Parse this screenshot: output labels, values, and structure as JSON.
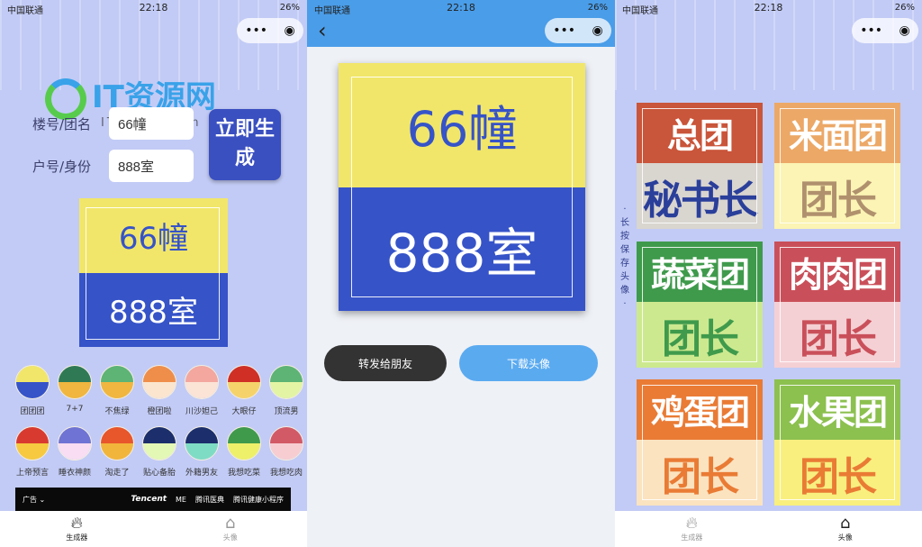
{
  "status": {
    "carrier": "中国联通",
    "time": "22:18",
    "battery": "26%"
  },
  "capsule": {
    "more": "•••",
    "close": "◉"
  },
  "generator": {
    "watermark": "IT资源网",
    "watermark_url": "ITbaizu.com",
    "building_label": "楼号/团名",
    "building_value": "66幢",
    "room_label": "户号/身份",
    "room_value": "888室",
    "generate_button": "立即生成",
    "preview": {
      "top": "66幢",
      "bottom": "888室",
      "top_color": "#f1e66a",
      "bottom_color": "#3653c8"
    },
    "themes": [
      {
        "name": "团团团",
        "top": "#f1e66a",
        "bottom": "#3653c8"
      },
      {
        "name": "7+7",
        "top": "#2f7a55",
        "bottom": "#f0b63f"
      },
      {
        "name": "不焦绿",
        "top": "#5db474",
        "bottom": "#f0b63f"
      },
      {
        "name": "橙团啦",
        "top": "#ef8e4a",
        "bottom": "#fbe5cf"
      },
      {
        "name": "川沙妲己",
        "top": "#f3a79e",
        "bottom": "#fbe3d6"
      },
      {
        "name": "大眼仔",
        "top": "#cf2f25",
        "bottom": "#f6d36a"
      },
      {
        "name": "顶流男",
        "top": "#5db474",
        "bottom": "#e3f5a4"
      },
      {
        "name": "上帝预言",
        "top": "#d93a30",
        "bottom": "#f6c940"
      },
      {
        "name": "睡衣神颜",
        "top": "#6f73d3",
        "bottom": "#f8ddf3"
      },
      {
        "name": "淘走了",
        "top": "#e8562c",
        "bottom": "#f2b53c"
      },
      {
        "name": "贴心备胎",
        "top": "#1c2f6c",
        "bottom": "#e4f8b6"
      },
      {
        "name": "外籍男友",
        "top": "#1c2f6c",
        "bottom": "#7fdcc4"
      },
      {
        "name": "我想吃菜",
        "top": "#3f9a4c",
        "bottom": "#eef06a"
      },
      {
        "name": "我想吃肉",
        "top": "#d25a66",
        "bottom": "#f7cdd2"
      }
    ],
    "ad": {
      "label": "广告 ⌄",
      "brands": [
        "Tencent",
        "ME",
        "腾讯医典",
        "腾讯健康小程序"
      ]
    }
  },
  "tabs": [
    {
      "label": "生成器",
      "icon": "flame-icon"
    },
    {
      "label": "头像",
      "icon": "home-icon"
    }
  ],
  "result": {
    "back": "‹",
    "preview": {
      "top": "66幢",
      "bottom": "888室"
    },
    "share_button": "转发给朋友",
    "download_button": "下载头像"
  },
  "gallery": {
    "hint": "·长按保存头像·",
    "cards": [
      {
        "top": "总团",
        "bottom": "秘书长",
        "top_color": "#c9553a",
        "bottom_color": "#d9d5cf",
        "text_color": "#2a3f9a"
      },
      {
        "top": "米面团",
        "bottom": "团长",
        "top_color": "#eca867",
        "bottom_color": "#fbf4b4",
        "text_color": "#b0916e"
      },
      {
        "top": "蔬菜团",
        "bottom": "团长",
        "top_color": "#3f9a4c",
        "bottom_color": "#cde98f",
        "text_color": "#3f9a4c"
      },
      {
        "top": "肉肉团",
        "bottom": "团长",
        "top_color": "#c9505a",
        "bottom_color": "#f4d0d4",
        "text_color": "#c9505a"
      },
      {
        "top": "鸡蛋团",
        "bottom": "团长",
        "top_color": "#e97b35",
        "bottom_color": "#fbe3c0",
        "text_color": "#e97b35"
      },
      {
        "top": "水果团",
        "bottom": "团长",
        "top_color": "#8cc04f",
        "bottom_color": "#f8ef7f",
        "text_color": "#e97b35"
      }
    ]
  }
}
